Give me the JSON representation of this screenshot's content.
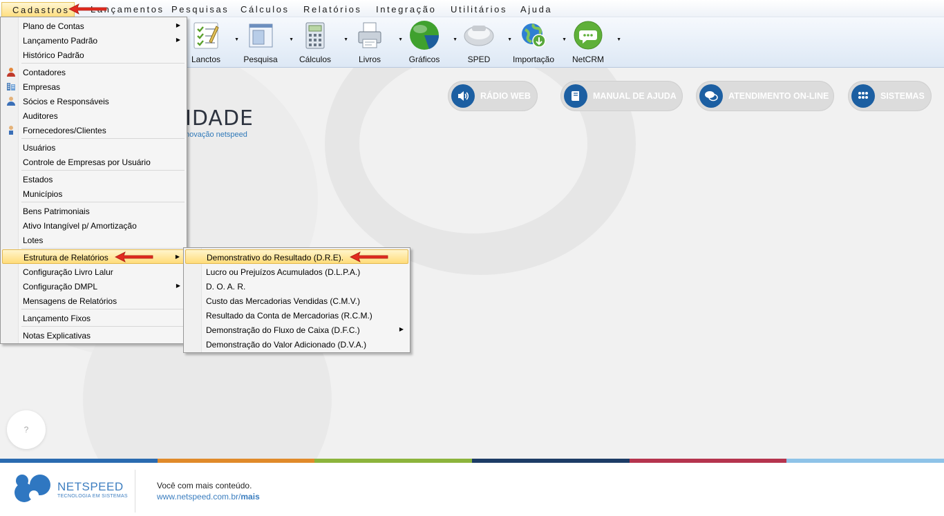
{
  "menubar": {
    "items": [
      "Cadastros",
      "Lançamentos",
      "Pesquisas",
      "Cálculos",
      "Relatórios",
      "Integração",
      "Utilitários",
      "Ajuda"
    ]
  },
  "toolbar": {
    "buttons": [
      {
        "label": "Lanctos"
      },
      {
        "label": "Pesquisa"
      },
      {
        "label": "Cálculos"
      },
      {
        "label": "Livros"
      },
      {
        "label": "Gráficos"
      },
      {
        "label": "SPED"
      },
      {
        "label": "Importação"
      },
      {
        "label": "NetCRM"
      }
    ]
  },
  "content": {
    "logo_text": "IDADE",
    "logo_sub": "novação netspeed",
    "pills": [
      {
        "label": "RÁDIO WEB",
        "icon": "speaker-icon"
      },
      {
        "label": "MANUAL DE AJUDA",
        "icon": "book-icon"
      },
      {
        "label": "ATENDIMENTO ON-LINE",
        "icon": "chat-icon"
      },
      {
        "label": "SISTEMAS",
        "icon": "grid-icon"
      }
    ],
    "help": "?"
  },
  "cadastros_menu": {
    "items": [
      {
        "label": "Plano de Contas",
        "submenu": true
      },
      {
        "label": "Lançamento Padrão",
        "submenu": true
      },
      {
        "label": "Histórico Padrão"
      },
      {
        "label": "Contadores",
        "icon": "person-icon"
      },
      {
        "label": "Empresas",
        "icon": "building-icon"
      },
      {
        "label": "Sócios e Responsáveis",
        "icon": "partners-icon"
      },
      {
        "label": "Auditores"
      },
      {
        "label": "Fornecedores/Clientes",
        "icon": "supplier-icon"
      },
      {
        "label": "Usuários"
      },
      {
        "label": "Controle de Empresas por Usuário"
      },
      {
        "label": "Estados"
      },
      {
        "label": "Municípios"
      },
      {
        "label": "Bens Patrimoniais"
      },
      {
        "label": "Ativo Intangível p/ Amortização"
      },
      {
        "label": "Lotes"
      },
      {
        "label": "Estrutura de Relatórios",
        "submenu": true
      },
      {
        "label": "Configuração Livro Lalur"
      },
      {
        "label": "Configuração DMPL",
        "submenu": true
      },
      {
        "label": "Mensagens de Relatórios"
      },
      {
        "label": "Lançamento Fixos"
      },
      {
        "label": "Notas Explicativas"
      }
    ]
  },
  "relatorios_submenu": {
    "items": [
      {
        "label": "Demonstrativo do Resultado (D.R.E)."
      },
      {
        "label": "Lucro ou Prejuízos Acumulados (D.L.P.A.)"
      },
      {
        "label": "D. O. A. R."
      },
      {
        "label": "Custo das Mercadorias Vendidas (C.M.V.)"
      },
      {
        "label": "Resultado da Conta de Mercadorias (R.C.M.)"
      },
      {
        "label": "Demonstração do Fluxo de Caixa (D.F.C.)",
        "submenu": true
      },
      {
        "label": "Demonstração do Valor Adicionado (D.V.A.)"
      }
    ]
  },
  "footer": {
    "brand": "NETSPEED",
    "tagline": "TECNOLOGIA EM SISTEMAS",
    "line1": "Você com mais conteúdo.",
    "url_prefix": "www.netspeed.com.br/",
    "url_bold": "mais"
  },
  "colors": {
    "strip": [
      "#2b6bb0",
      "#e08a2b",
      "#8cb43c",
      "#1d3c66",
      "#b5344e",
      "#8ec3e8"
    ],
    "highlight": "#ffdc7a",
    "accent": "#1c5fa2"
  }
}
